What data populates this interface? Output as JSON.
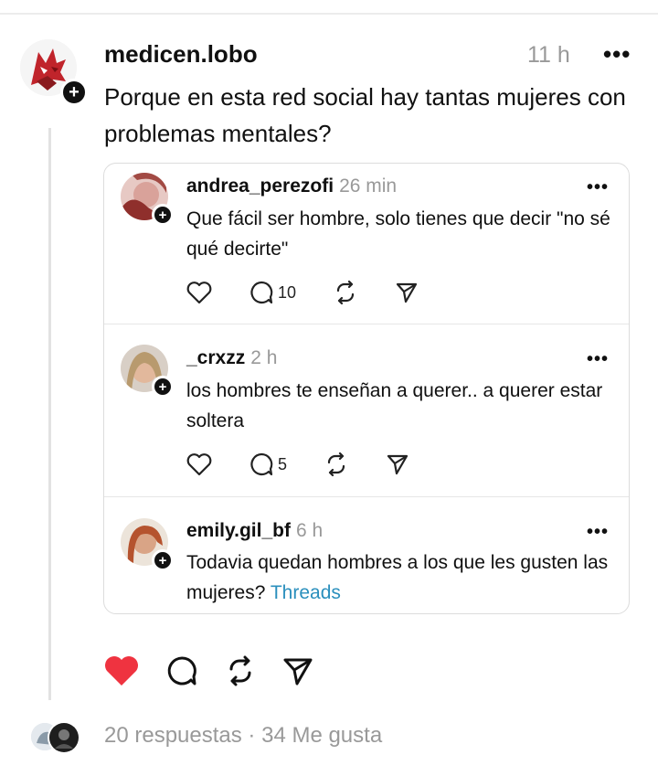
{
  "post": {
    "username": "medicen.lobo",
    "time": "11 h",
    "text": "Porque en esta red social hay tantas mujeres con problemas mentales?",
    "more_icon": "more-dots-icon",
    "liked": true,
    "like_color": "#ef3340"
  },
  "replies": [
    {
      "username": "andrea_perezofi",
      "time": "26 min",
      "text": "Que fácil ser hombre, solo tienes que decir \"no sé qué decirte\"",
      "reply_count": "10"
    },
    {
      "username": "_crxzz",
      "time": "2 h",
      "text": "los hombres te enseñan a querer.. a querer estar soltera",
      "reply_count": "5"
    },
    {
      "username": "emily.gil_bf",
      "time": "6 h",
      "text": "Todavia quedan hombres a los que les gusten las mujeres?",
      "link": "Threads"
    }
  ],
  "footer": {
    "summary": "20 respuestas · 34 Me gusta"
  }
}
